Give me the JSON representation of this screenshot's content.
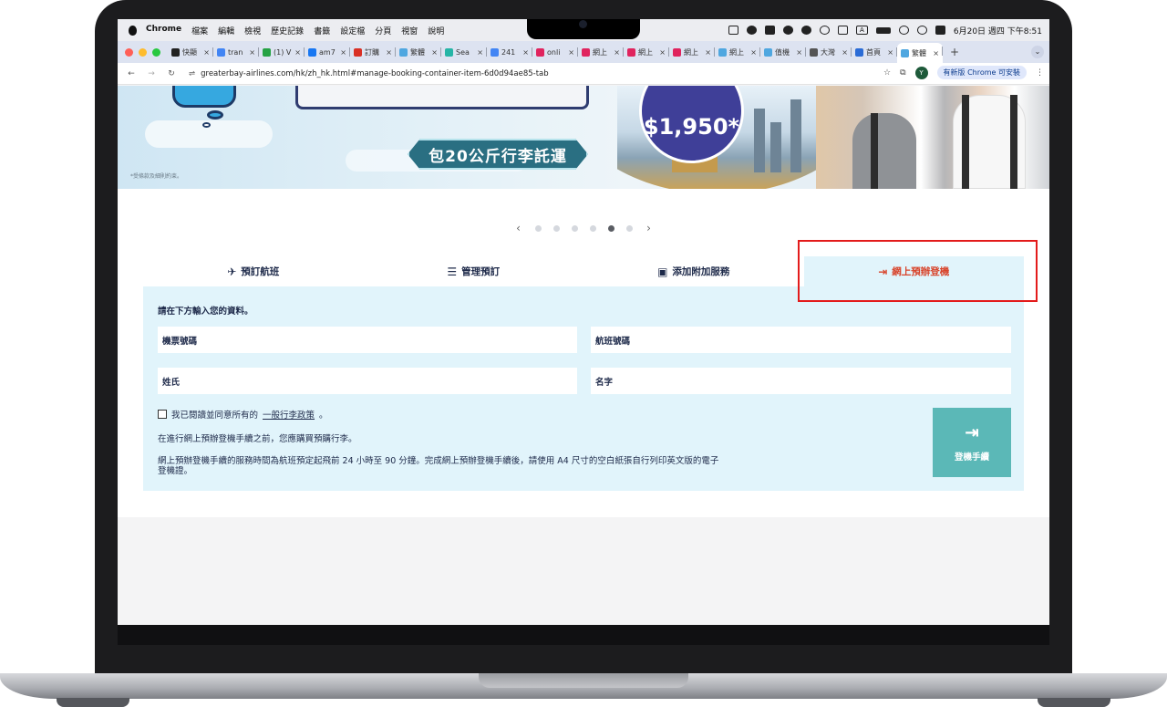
{
  "menubar": {
    "app": "Chrome",
    "menus": [
      "檔案",
      "編輯",
      "檢視",
      "歷史記錄",
      "書籤",
      "設定檔",
      "分頁",
      "視窗",
      "說明"
    ],
    "datetime": "6月20日 週四 下午8:51",
    "input_indicator": "A"
  },
  "tabs": [
    {
      "label": "快顯",
      "color": "#222222"
    },
    {
      "label": "tran",
      "color": "#4285f4"
    },
    {
      "label": "(1) V",
      "color": "#25a244"
    },
    {
      "label": "am7",
      "color": "#1877f2"
    },
    {
      "label": "訂購",
      "color": "#d93025"
    },
    {
      "label": "繁體",
      "color": "#4fa7e0"
    },
    {
      "label": "Sea",
      "color": "#26b5a6"
    },
    {
      "label": "241",
      "color": "#4285f4"
    },
    {
      "label": "onli",
      "color": "#e0245e"
    },
    {
      "label": "網上",
      "color": "#e0245e"
    },
    {
      "label": "網上",
      "color": "#e0245e"
    },
    {
      "label": "網上",
      "color": "#e0245e"
    },
    {
      "label": "網上",
      "color": "#4fa7e0"
    },
    {
      "label": "值機",
      "color": "#4fa7e0"
    },
    {
      "label": "大灣",
      "color": "#555555"
    },
    {
      "label": "首頁",
      "color": "#2b6cd6"
    },
    {
      "label": "繁體",
      "color": "#4fa7e0"
    }
  ],
  "tab_close": "×",
  "new_tab": "+",
  "toolbar": {
    "url": "greaterbay-airlines.com/hk/zh_hk.html#manage-booking-container-item-6d0d94ae85-tab",
    "avatar": "Y",
    "update_label": "有新版 Chrome 可安裝"
  },
  "hero": {
    "price": "$1,950*",
    "ribbon": "包20公斤行李託運",
    "disclaimer": "*受條款及細則約束。"
  },
  "carousel": {
    "prev": "‹",
    "next": "›",
    "count": 6,
    "active": 5
  },
  "booking_tabs": [
    {
      "label": "預訂航班",
      "icon": "plane-icon",
      "glyph": "✈"
    },
    {
      "label": "管理預訂",
      "icon": "list-icon",
      "glyph": "☰"
    },
    {
      "label": "添加附加服務",
      "icon": "luggage-icon",
      "glyph": "▣"
    },
    {
      "label": "網上預辦登機",
      "icon": "mobile-checkin-icon",
      "glyph": "⇥"
    }
  ],
  "form": {
    "intro": "請在下方輸入您的資料。",
    "ticket_number_placeholder": "機票號碼",
    "flight_number_placeholder": "航班號碼",
    "surname_placeholder": "姓氏",
    "given_name_placeholder": "名字",
    "agree_prefix": "我已閱讀並同意所有的",
    "agree_link": "一般行李政策",
    "agree_suffix": "。",
    "note_baggage": "在進行網上預辦登機手續之前，您應購買預購行李。",
    "note_timing": "網上預辦登機手續的服務時間為航班預定起飛前 24 小時至 90 分鐘。完成網上預辦登機手續後，請使用 A4 尺寸的空白紙張自行列印英文版的電子登機證。",
    "checkin_button": "登機手續"
  },
  "colors": {
    "active_tab_text": "#d8432a",
    "panel_bg": "#e1f4fb",
    "checkin_button": "#5bb8b7",
    "highlight_box": "#e31b1b"
  }
}
